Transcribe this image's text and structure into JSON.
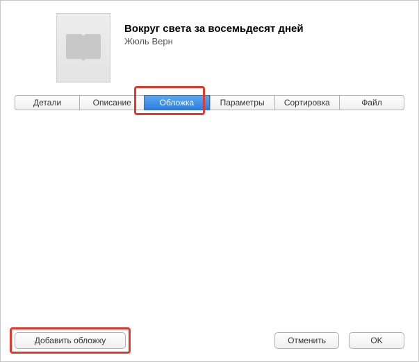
{
  "book": {
    "title": "Вокруг света за восемьдесят дней",
    "author": "Жюль  Верн"
  },
  "tabs": {
    "details": "Детали",
    "description": "Описание",
    "cover": "Обложка",
    "options": "Параметры",
    "sorting": "Сортировка",
    "file": "Файл"
  },
  "buttons": {
    "add_cover": "Добавить обложку",
    "cancel": "Отменить",
    "ok": "OK"
  }
}
